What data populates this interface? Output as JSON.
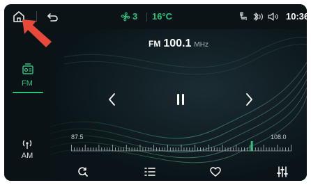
{
  "status_bar": {
    "home_icon": "home-icon",
    "back_icon": "back-arrow-icon",
    "fan_icon": "fan-icon",
    "fan_level": "3",
    "temperature": "16°C",
    "seat_icon": "seat-icon",
    "bluetooth_icon": "bluetooth-icon",
    "volume_icon": "speaker-icon",
    "time": "10:36"
  },
  "sidebar": {
    "items": [
      {
        "label": "FM",
        "icon": "radio-icon",
        "active": true
      },
      {
        "label": "AM",
        "icon": "broadcast-icon",
        "active": false
      }
    ]
  },
  "radio": {
    "band": "FM",
    "frequency": "100.1",
    "unit": "MHz",
    "dial_min": "87.5",
    "dial_max": "108.0",
    "dial_fraction": 0.82
  },
  "controls": {
    "prev_icon": "chevron-left-icon",
    "play_pause_icon": "pause-icon",
    "next_icon": "chevron-right-icon",
    "search_icon": "search-icon",
    "list_icon": "list-icon",
    "favorite_icon": "heart-icon",
    "equalizer_icon": "equalizer-icon"
  },
  "colors": {
    "accent": "#2ec27e",
    "annotation_arrow": "#e8493a"
  }
}
